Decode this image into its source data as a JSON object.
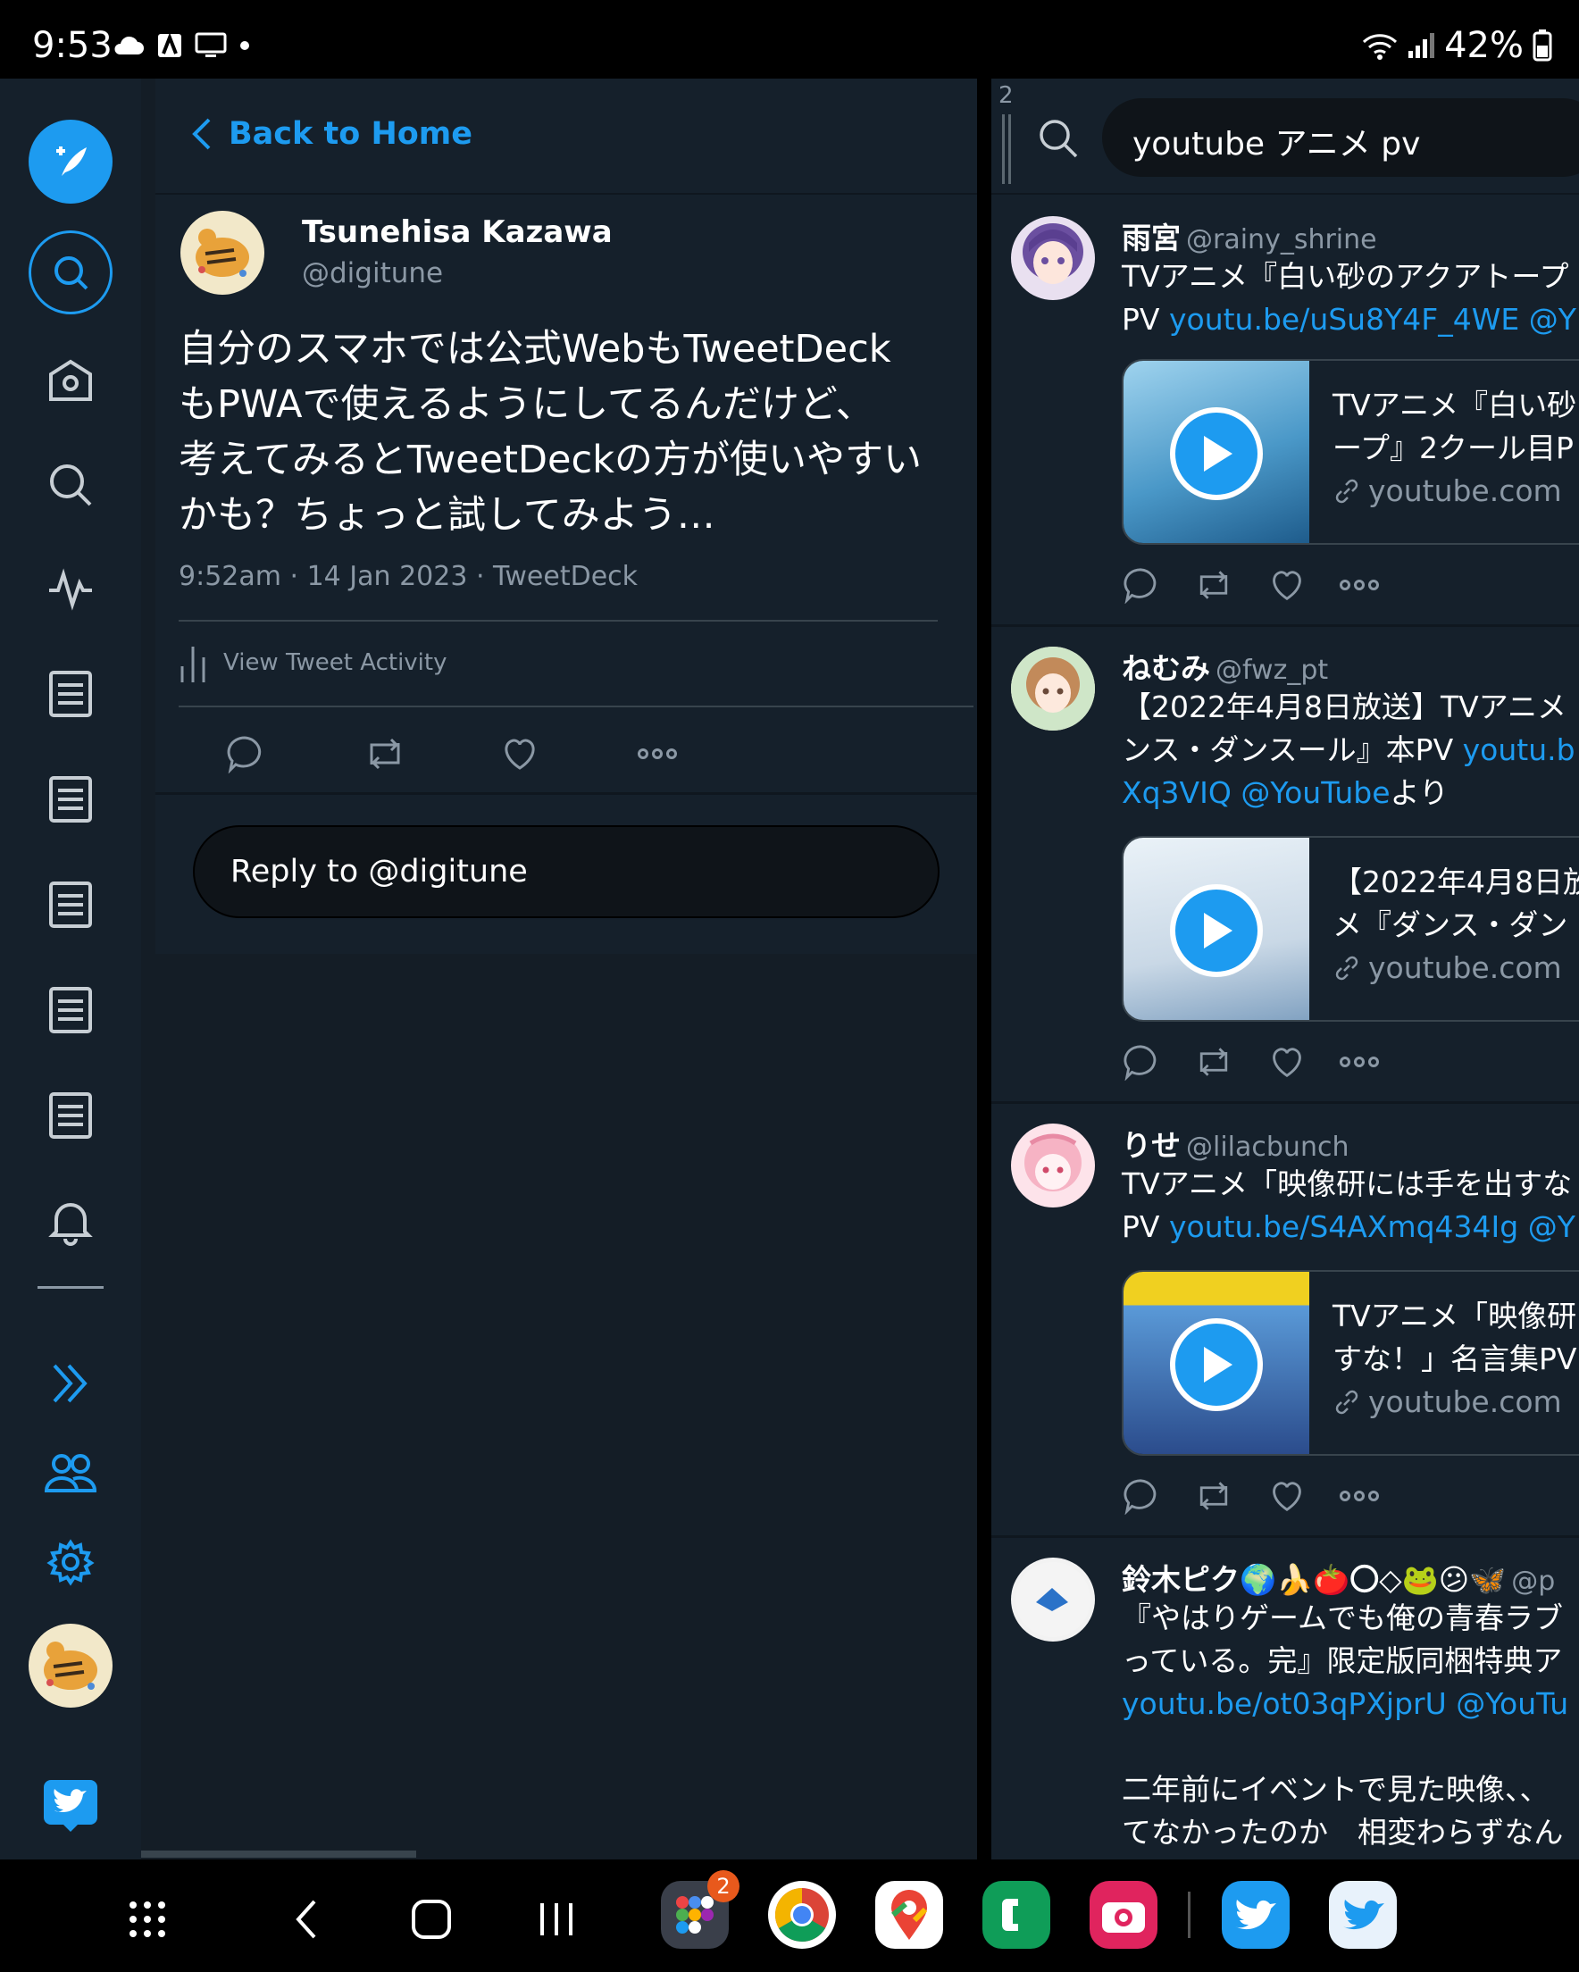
{
  "status_bar": {
    "time": "9:53",
    "battery": "42%"
  },
  "column1": {
    "back_label": "Back to Home",
    "tweet": {
      "name": "Tsunehisa Kazawa",
      "handle": "@digitune",
      "text_lines": [
        "自分のスマホでは公式WebもTweetDeck",
        "もPWAで使えるようにしてるんだけど、",
        "考えてみるとTweetDeckの方が使いやすい",
        "かも？ちょっと試してみよう…"
      ],
      "meta": "9:52am · 14 Jan 2023 · TweetDeck",
      "activity_label": "View Tweet Activity"
    },
    "reply_placeholder": "Reply to @digitune"
  },
  "column2": {
    "number": "2",
    "search_query": "youtube アニメ pv",
    "tweets": [
      {
        "name": "雨宮",
        "handle": "@rainy_shrine",
        "line1": "TVアニメ『白い砂のアクアトープ",
        "line2_text": "PV ",
        "line2_link": "youtu.be/uSu8Y4F_4WE @Y",
        "card_title1": "TVアニメ『白い砂",
        "card_title2": "ープ』2クール目P",
        "card_domain": "youtube.com"
      },
      {
        "name": "ねむみ",
        "handle": "@fwz_pt",
        "line1": "【2022年4月8日放送】TVアニメ",
        "line2_text": "ンス・ダンスール』本PV ",
        "line2_link": "youtu.b",
        "line3_link": "Xq3VIQ @YouTube",
        "line3_text": "より",
        "card_title1": "【2022年4月8日放",
        "card_title2": "メ『ダンス・ダン",
        "card_domain": "youtube.com"
      },
      {
        "name": "りせ",
        "handle": "@lilacbunch",
        "line1": "TVアニメ「映像研には手を出すな",
        "line2_text": "PV ",
        "line2_link": "youtu.be/S4AXmq434Ig @Y",
        "card_title1": "TVアニメ「映像研",
        "card_title2": "すな！」名言集PV",
        "card_domain": "youtube.com"
      },
      {
        "name": "鈴木ピク🌍🍌🍅〇◇🐸😕🦋",
        "handle": "@p",
        "line1": "『やはりゲームでも俺の青春ラブ",
        "line2": "っている。完』限定版同梱特典ア",
        "line3_link": "youtu.be/ot03qPXjprU @YouTu",
        "line4": "二年前にイベントで見た映像、、",
        "line5": "てなかったのか　相変わらずなん"
      }
    ]
  },
  "navbar": {
    "apps_badge": "2"
  },
  "colors": {
    "accent": "#1d9bf0",
    "bg": "#15202b",
    "muted": "#8b98a5"
  }
}
